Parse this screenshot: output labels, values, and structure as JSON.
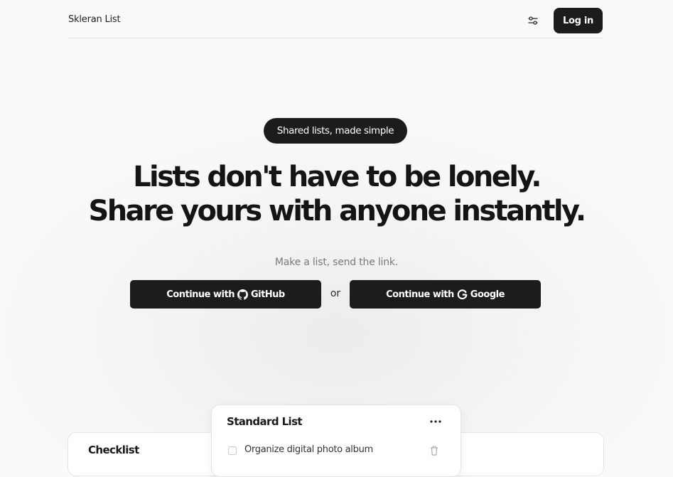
{
  "header": {
    "brand": "Skleran List",
    "settings_icon": "sliders-icon",
    "login_label": "Log in"
  },
  "hero": {
    "badge": "Shared lists, made simple",
    "headline_line1": "Lists don't have to be lonely.",
    "headline_line2": "Share yours with anyone instantly.",
    "subtitle": "Make a list, send the link.",
    "github_cta": {
      "label": "Continue with",
      "provider": "GitHub",
      "icon": "github-icon"
    },
    "separator": "or",
    "google_cta": {
      "label": "Continue with",
      "provider": "Google",
      "icon": "google-icon"
    }
  },
  "preview": {
    "left_card_title": "Checklist",
    "front_card": {
      "title": "Standard List",
      "more_icon": "ellipsis-icon",
      "items": [
        {
          "text": "Organize digital photo album",
          "icon": "trash-icon"
        }
      ]
    }
  },
  "colors": {
    "primary": "#1c1c1c",
    "background": "#f6f6f6",
    "muted_text": "#7a7a7a"
  }
}
